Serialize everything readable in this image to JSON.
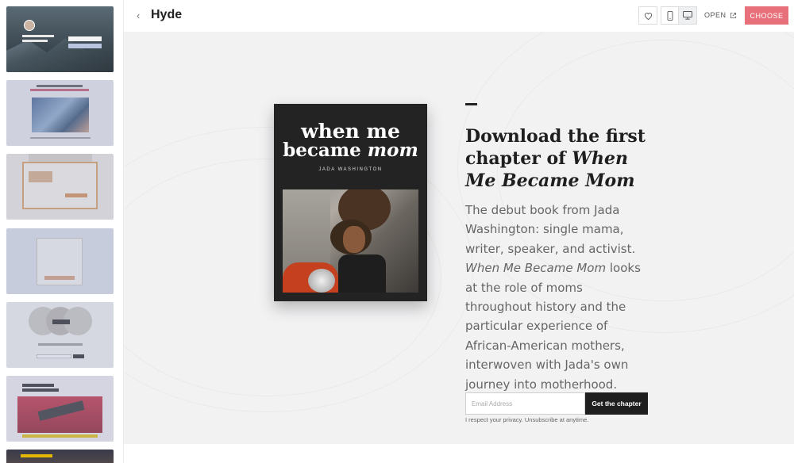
{
  "header": {
    "back_icon": "chevron-left-icon",
    "title": "Hyde",
    "open_label": "OPEN",
    "choose_label": "CHOOSE",
    "choose_color": "#e8707a"
  },
  "book": {
    "title_line1": "when me",
    "title_line2_prefix": "became",
    "title_line2_italic": "mom",
    "author": "JADA WASHINGTON"
  },
  "main": {
    "headline_prefix": "Download the first chapter of",
    "headline_italic": "When Me Became Mom",
    "body_prefix": "The debut book from Jada Washington: single mama, writer, speaker, and activist.",
    "body_italic": "When Me Became Mom",
    "body_suffix": "looks at the role of moms throughout history and the particular experience of African-American mothers, interwoven with Jada's own journey into motherhood.",
    "email_placeholder": "Email Address",
    "button_label": "Get the chapter",
    "privacy_text": "I respect your privacy. Unsubscribe at anytime."
  }
}
